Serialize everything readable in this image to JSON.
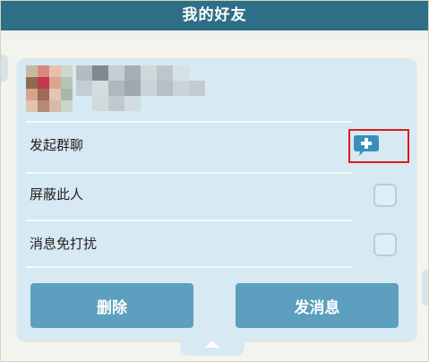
{
  "window": {
    "title": "我的好友"
  },
  "profile": {
    "avatar": "blurred-avatar",
    "name": ""
  },
  "options": [
    {
      "key": "group-chat",
      "label": "发起群聊",
      "control": "add-button"
    },
    {
      "key": "block",
      "label": "屏蔽此人",
      "control": "checkbox",
      "checked": false
    },
    {
      "key": "mute",
      "label": "消息免打扰",
      "control": "checkbox",
      "checked": false
    }
  ],
  "buttons": {
    "delete": "删除",
    "send_message": "发消息"
  },
  "icons": {
    "add": "plus-chat-bubble-icon",
    "expand": "chevron-up-icon"
  },
  "colors": {
    "header": "#2e6f87",
    "panel": "#d7e9f2",
    "button": "#5c9fbe",
    "highlight": "#e01919"
  }
}
